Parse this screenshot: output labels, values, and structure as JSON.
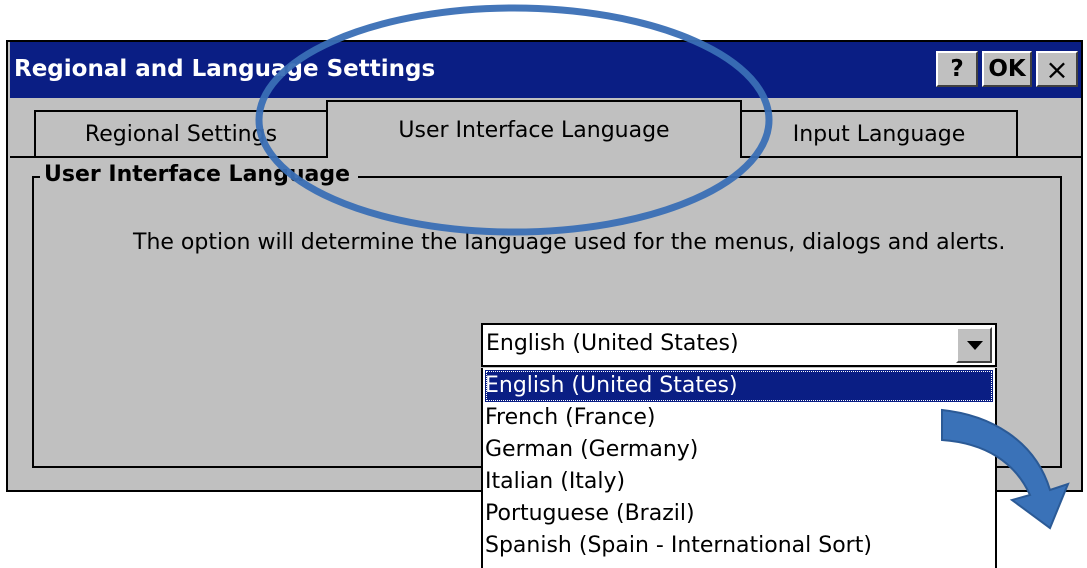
{
  "window": {
    "title": "Regional and Language Settings",
    "help_label": "?",
    "ok_label": "OK",
    "close_label": "×"
  },
  "tabs": [
    {
      "label": "Regional Settings",
      "active": false
    },
    {
      "label": "User Interface Language",
      "active": true
    },
    {
      "label": "Input Language",
      "active": false
    }
  ],
  "group": {
    "legend": "User Interface Language",
    "description": "The option will determine the language used for the menus, dialogs and alerts."
  },
  "language_select": {
    "value": "English (United States)",
    "options": [
      "English (United States)",
      "French (France)",
      "German (Germany)",
      "Italian (Italy)",
      "Portuguese (Brazil)",
      "Spanish (Spain - International Sort)"
    ],
    "selected_index": 0
  },
  "colors": {
    "titlebar": "#0a1e84",
    "window_bg": "#c0c0c0",
    "annotation": "#3a6fb5"
  },
  "annotations": {
    "ellipse_icon": "highlight-ellipse",
    "arrow_icon": "curved-down-arrow"
  }
}
